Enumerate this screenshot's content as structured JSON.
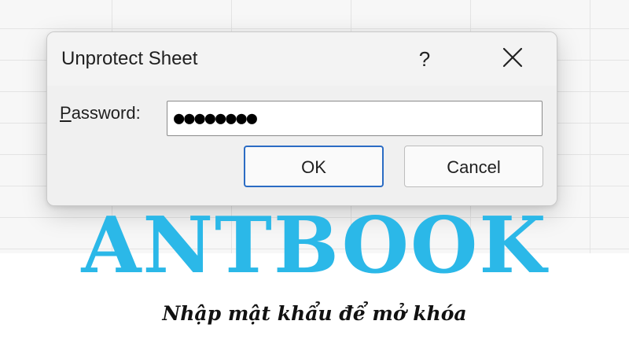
{
  "dialog": {
    "title": "Unprotect Sheet",
    "help_label": "?",
    "password_label_mnemonic": "P",
    "password_label_rest": "assword:",
    "password_value": "●●●●●●●●",
    "ok_label": "OK",
    "cancel_label": "Cancel"
  },
  "icons": {
    "close": "close-icon"
  },
  "overlay": {
    "brand": "ANTBOOK",
    "tagline": "Nhập mật khẩu để mở khóa"
  },
  "colors": {
    "brand": "#2bb8e8",
    "ok_border": "#2b6cc4",
    "dialog_bg": "#f0f0f0"
  }
}
